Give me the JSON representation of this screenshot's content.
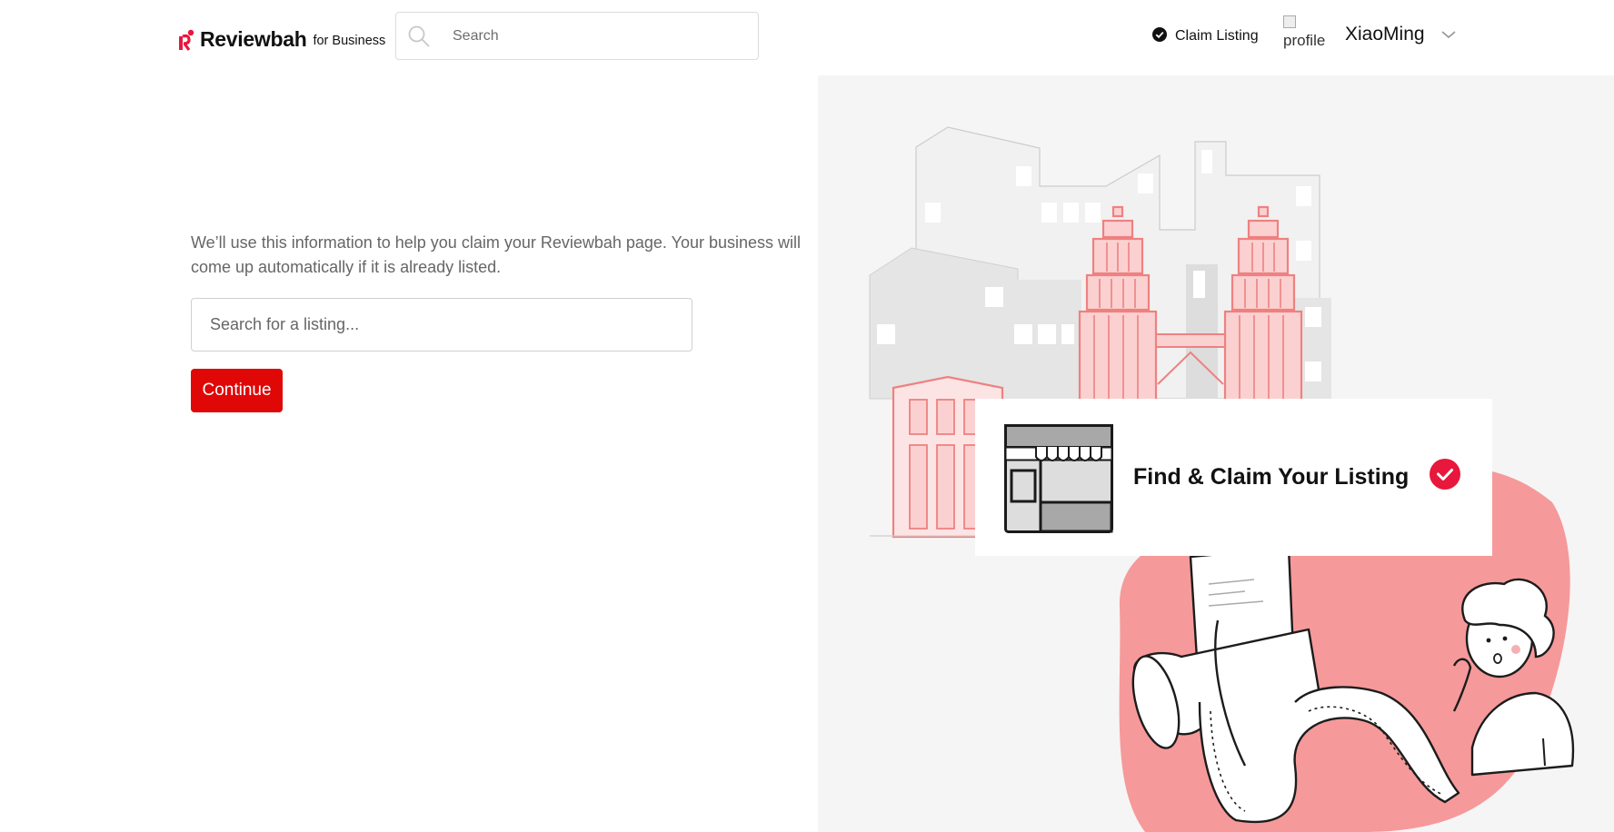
{
  "header": {
    "logo_brand": "Reviewbah",
    "logo_suffix": "for Business",
    "search_placeholder": "Search",
    "claim_listing_label": "Claim Listing",
    "avatar_alt": "profile",
    "username": "XiaoMing"
  },
  "main": {
    "intro_text": "We’ll use this information to help you claim your Reviewbah page. Your business will come up automatically if it is already listed.",
    "listing_search_placeholder": "Search for a listing...",
    "continue_label": "Continue"
  },
  "illustration": {
    "card_title": "Find & Claim Your Listing"
  },
  "colors": {
    "brand_red": "#e00707",
    "check_red": "#e8173c",
    "blob_pink": "#f6999a"
  },
  "icons": {
    "search": "search-icon",
    "claim": "check-circle-icon",
    "user_menu": "chevron-down-icon",
    "store": "storefront-icon",
    "card_check": "check-badge-icon"
  }
}
